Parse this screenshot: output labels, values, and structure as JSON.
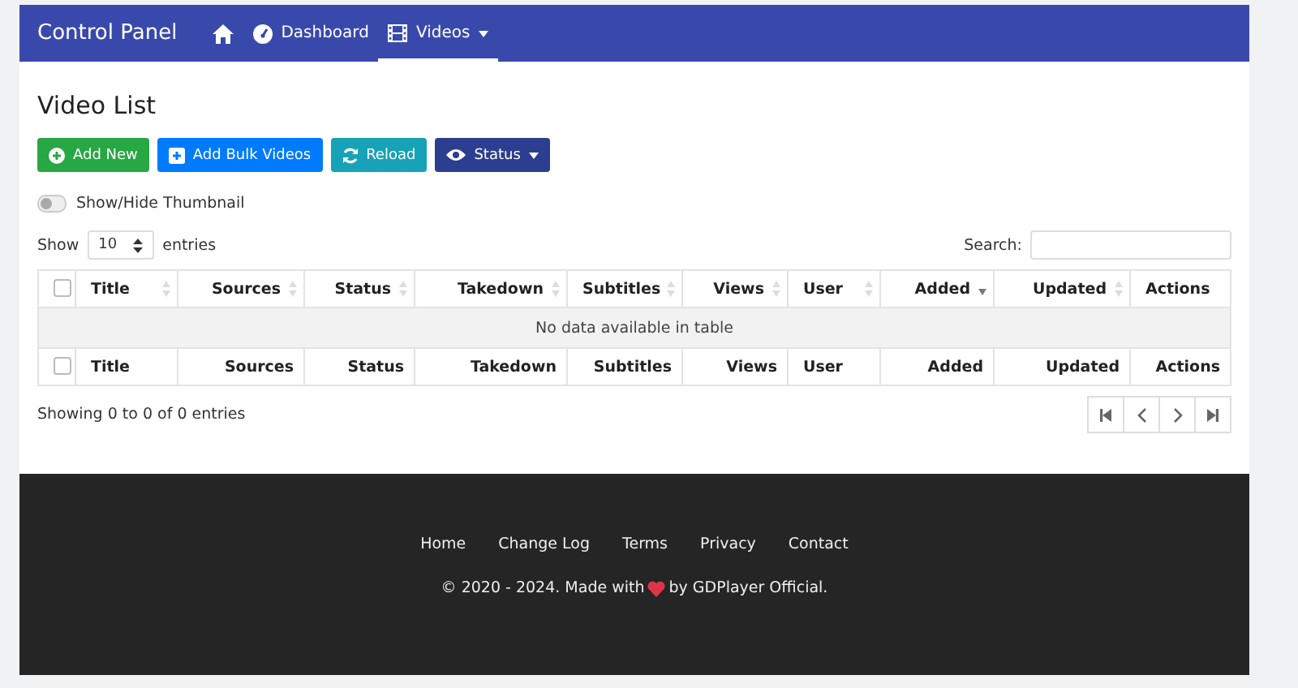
{
  "navbar": {
    "brand": "Control Panel",
    "items": [
      {
        "kind": "home",
        "selected": false
      },
      {
        "kind": "dashboard",
        "label": "Dashboard",
        "selected": false
      },
      {
        "kind": "videos",
        "label": "Videos",
        "selected": true,
        "dropdown": true
      }
    ]
  },
  "page_title": "Video List",
  "actions": [
    {
      "kind": "add",
      "label": "Add New",
      "color": "#28a745"
    },
    {
      "kind": "bulk",
      "label": "Add Bulk Videos",
      "color": "#007bff"
    },
    {
      "kind": "reload",
      "label": "Reload",
      "color": "#17a2b8"
    },
    {
      "kind": "status",
      "label": "Status",
      "color": "#2c3e8f",
      "dropdown": true
    }
  ],
  "thumbnail_toggle": {
    "label": "Show/Hide Thumbnail",
    "on": false
  },
  "length": {
    "before": "Show",
    "value": "10",
    "after": "entries"
  },
  "search": {
    "label": "Search:"
  },
  "table": {
    "header": [
      {
        "kind": "check",
        "checked": false
      },
      {
        "label": "Title",
        "sortable": true,
        "sorted_desc": false
      },
      {
        "label": "Sources",
        "sortable": true,
        "sorted_desc": false
      },
      {
        "label": "Status",
        "sortable": true,
        "sorted_desc": false
      },
      {
        "label": "Takedown",
        "sortable": true,
        "sorted_desc": false
      },
      {
        "label": "Subtitles",
        "sortable": true,
        "sorted_desc": false
      },
      {
        "label": "Views",
        "sortable": true,
        "sorted_desc": false
      },
      {
        "label": "User",
        "sortable": true,
        "sorted_desc": false
      },
      {
        "label": "Added",
        "sortable": true,
        "sorted_desc": true
      },
      {
        "label": "Updated",
        "sortable": true,
        "sorted_desc": false
      },
      {
        "label": "Actions"
      }
    ],
    "empty_message": "No data available in table",
    "footer": [
      {
        "kind": "check",
        "checked": false
      },
      {
        "label": "Title"
      },
      {
        "label": "Sources"
      },
      {
        "label": "Status"
      },
      {
        "label": "Takedown"
      },
      {
        "label": "Subtitles"
      },
      {
        "label": "Views"
      },
      {
        "label": "User"
      },
      {
        "label": "Added"
      },
      {
        "label": "Updated"
      },
      {
        "label": "Actions"
      }
    ]
  },
  "info": "Showing 0 to 0 of 0 entries",
  "pagination": [
    {
      "kind": "first",
      "disabled": true
    },
    {
      "kind": "prev",
      "disabled": true
    },
    {
      "kind": "next",
      "disabled": true
    },
    {
      "kind": "last",
      "disabled": true
    }
  ],
  "footer": {
    "links": [
      "Home",
      "Change Log",
      "Terms",
      "Privacy",
      "Contact"
    ],
    "copyright_before": "© 2020 - 2024. Made with",
    "copyright_after": "by GDPlayer Official."
  }
}
